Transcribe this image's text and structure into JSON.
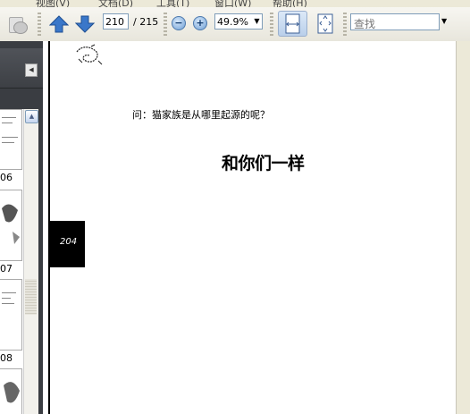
{
  "menu": {
    "items": [
      "视图(V)",
      "文档(D)",
      "工具(T)",
      "窗口(W)",
      "帮助(H)"
    ]
  },
  "toolbar": {
    "page_current": "210",
    "page_total": "/ 215",
    "zoom": "49.9%",
    "find_placeholder": "查找"
  },
  "sidebar": {
    "thumbnail_labels": [
      "06",
      "07",
      "08"
    ]
  },
  "document": {
    "question": "问：猫家族是从哪里起源的呢？",
    "headline": "和你们一样",
    "page_number": "204"
  },
  "colors": {
    "sidebar_bg": "#3a3d42",
    "arrow_blue": "#3a77c9",
    "toolbar_bg": "#ece9d8"
  }
}
